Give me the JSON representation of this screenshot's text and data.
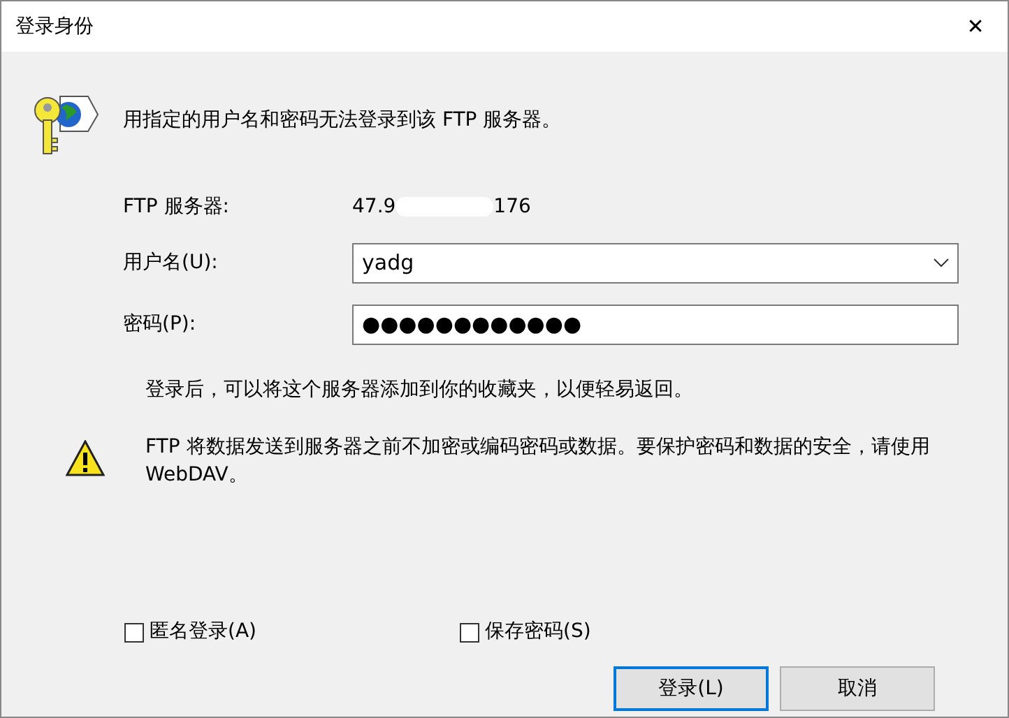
{
  "window": {
    "title": "登录身份",
    "close": "✕"
  },
  "message": "用指定的用户名和密码无法登录到该 FTP 服务器。",
  "server": {
    "label": "FTP 服务器:",
    "value_start": "47.9",
    "value_end": "176"
  },
  "username": {
    "label": "用户名(U):",
    "value": "yadg"
  },
  "password": {
    "label": "密码(P):",
    "value": "●●●●●●●●●●●●"
  },
  "hint": "登录后，可以将这个服务器添加到你的收藏夹，以便轻易返回。",
  "warning": "FTP 将数据发送到服务器之前不加密或编码密码或数据。要保护密码和数据的安全，请使用 WebDAV。",
  "checkboxes": [
    {
      "label": "匿名登录(A)",
      "checked": false
    },
    {
      "label": "保存密码(S)",
      "checked": false
    }
  ],
  "buttons": [
    {
      "label": "登录(L)",
      "default": true
    },
    {
      "label": "取消",
      "default": false
    }
  ]
}
